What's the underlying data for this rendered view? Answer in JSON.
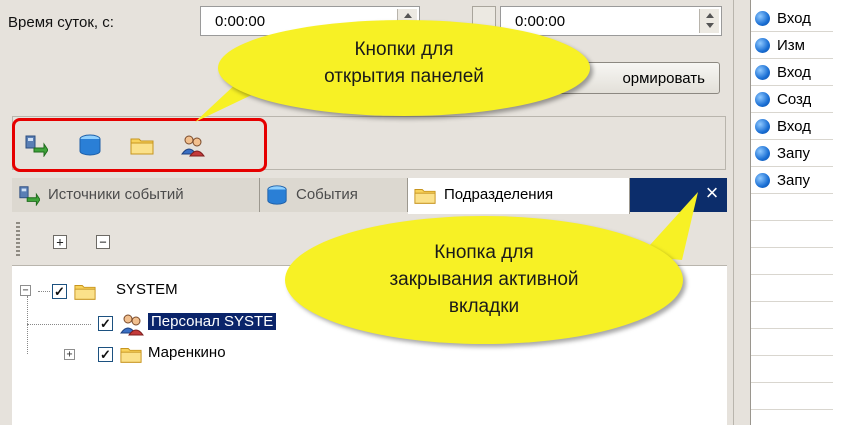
{
  "time_filter": {
    "label": "Время суток, с:",
    "from_value": "0:00:00",
    "to_value": "0:00:00"
  },
  "form_button": {
    "label": "ормировать"
  },
  "panel_buttons": [
    {
      "icon": "event-sources-icon"
    },
    {
      "icon": "events-icon"
    },
    {
      "icon": "folder-icon"
    },
    {
      "icon": "personnel-icon"
    }
  ],
  "tabs": [
    {
      "label": "Источники событий",
      "icon": "event-sources-icon",
      "active": false
    },
    {
      "label": "События",
      "icon": "events-icon",
      "active": false
    },
    {
      "label": "Подразделения",
      "icon": "folder-icon",
      "active": true
    }
  ],
  "tab_close_glyph": "×",
  "tree_toolbar": {
    "expand_glyph": "+",
    "collapse_glyph": "−"
  },
  "tree": {
    "root": {
      "label": "SYSTEM",
      "checked": true,
      "expanded": true
    },
    "children": [
      {
        "label": "Персонал SYSTE",
        "checked": true,
        "selected": true,
        "icon": "personnel-icon"
      },
      {
        "label": "Маренкино",
        "checked": true,
        "selected": false,
        "icon": "folder-icon"
      }
    ]
  },
  "right_list": [
    {
      "text": "Вход"
    },
    {
      "text": "Изм"
    },
    {
      "text": "Вход"
    },
    {
      "text": "Созд"
    },
    {
      "text": "Вход"
    },
    {
      "text": "Запу"
    },
    {
      "text": "Запу"
    }
  ],
  "callouts": [
    {
      "text": "Кнопки для\nоткрытия панелей"
    },
    {
      "text": "Кнопка для\nзакрывания активной\nвкладки"
    }
  ],
  "colors": {
    "callout_fill": "#f7f125",
    "highlight_frame": "#e60000",
    "tab_strip": "#0c2d6b",
    "selection": "#0a246a"
  }
}
